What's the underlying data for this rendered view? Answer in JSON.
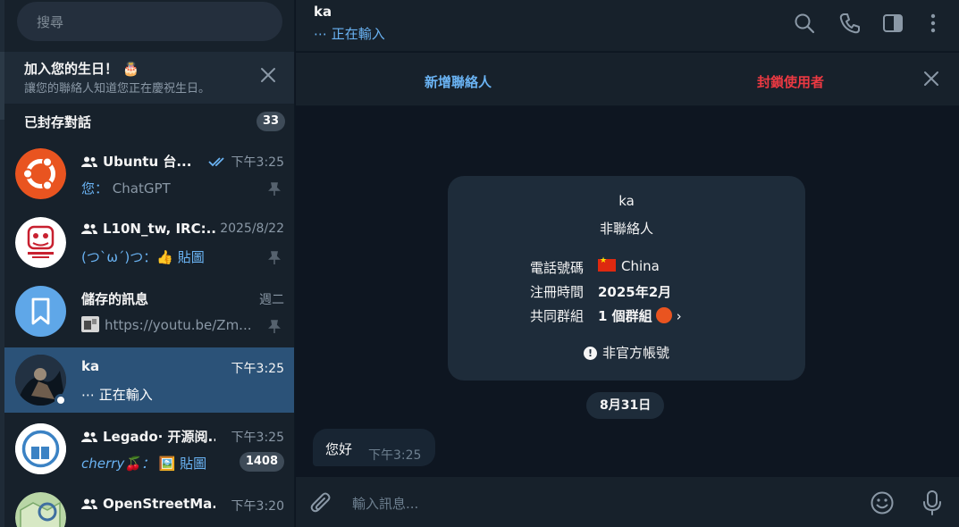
{
  "search": {
    "placeholder": "搜尋"
  },
  "birthday": {
    "title": "加入您的生日！ 🎂",
    "subtitle": "讓您的聯絡人知道您正在慶祝生日。"
  },
  "archived": {
    "label": "已封存對話",
    "count": "33"
  },
  "chats": [
    {
      "name": "Ubuntu 台...",
      "time": "下午3:25",
      "sender": "您：",
      "preview": "ChatGPT",
      "pinned": true
    },
    {
      "name": "L10N_tw, IRC:...",
      "time": "2025/8/22",
      "sender": "(つ`ω´)つ：",
      "preview": "👍 貼圖",
      "pinned": true
    },
    {
      "name": "儲存的訊息",
      "time": "週二",
      "preview": "https://youtu.be/Zm...",
      "pinned": true
    },
    {
      "name": "ka",
      "time": "下午3:25",
      "preview": "⋯ 正在輸入",
      "active": true
    },
    {
      "name": "Legado· 开源阅...",
      "time": "下午3:25",
      "sender": "cherry🍒：",
      "preview": "🖼️ 貼圖",
      "badge": "1408"
    },
    {
      "name": "OpenStreetMa...",
      "time": "下午3:20"
    }
  ],
  "header": {
    "name": "ka",
    "status": "⋯ 正在輸入"
  },
  "actions": {
    "add_contact": "新增聯絡人",
    "block_user": "封鎖使用者"
  },
  "info_card": {
    "name": "ka",
    "subtitle": "非聯絡人",
    "phone_label": "電話號碼",
    "phone_value": "China",
    "registered_label": "注冊時間",
    "registered_value": "2025年2月",
    "groups_label": "共同群組",
    "groups_value": "1 個群組",
    "footer": "非官方帳號"
  },
  "date_separator": "8月31日",
  "message": {
    "text": "您好",
    "time": "下午3:25"
  },
  "composer": {
    "placeholder": "輸入訊息..."
  },
  "colors": {
    "accent": "#6ab3f3",
    "danger": "#ec3942",
    "active_row": "#2b5278",
    "ubuntu": "#e95420"
  }
}
